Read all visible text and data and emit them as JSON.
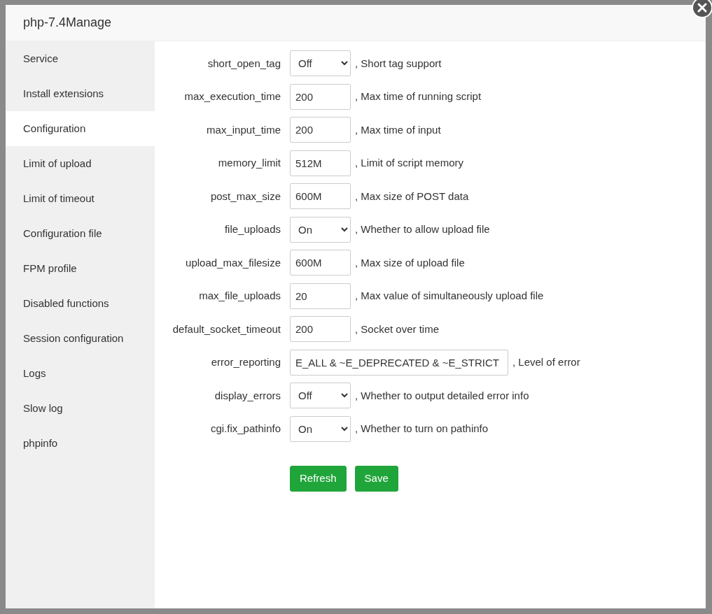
{
  "dialog": {
    "title": "php-7.4Manage"
  },
  "sidebar": {
    "items": [
      {
        "label": "Service",
        "selected": false
      },
      {
        "label": "Install extensions",
        "selected": false
      },
      {
        "label": "Configuration",
        "selected": true
      },
      {
        "label": "Limit of upload",
        "selected": false
      },
      {
        "label": "Limit of timeout",
        "selected": false
      },
      {
        "label": "Configuration file",
        "selected": false
      },
      {
        "label": "FPM profile",
        "selected": false
      },
      {
        "label": "Disabled functions",
        "selected": false
      },
      {
        "label": "Session configuration",
        "selected": false
      },
      {
        "label": "Logs",
        "selected": false
      },
      {
        "label": "Slow log",
        "selected": false
      },
      {
        "label": "phpinfo",
        "selected": false
      }
    ]
  },
  "settings": [
    {
      "label": "short_open_tag",
      "kind": "select",
      "value": "Off",
      "note": ", Short tag support"
    },
    {
      "label": "max_execution_time",
      "kind": "input",
      "value": "200",
      "note": ", Max time of running script"
    },
    {
      "label": "max_input_time",
      "kind": "input",
      "value": "200",
      "note": ", Max time of input"
    },
    {
      "label": "memory_limit",
      "kind": "input",
      "value": "512M",
      "note": ", Limit of script memory"
    },
    {
      "label": "post_max_size",
      "kind": "input",
      "value": "600M",
      "note": ", Max size of POST data"
    },
    {
      "label": "file_uploads",
      "kind": "select",
      "value": "On",
      "note": ", Whether to allow upload file"
    },
    {
      "label": "upload_max_filesize",
      "kind": "input",
      "value": "600M",
      "note": ", Max size of upload file"
    },
    {
      "label": "max_file_uploads",
      "kind": "input",
      "value": "20",
      "note": ", Max value of simultaneously upload file"
    },
    {
      "label": "default_socket_timeout",
      "kind": "input",
      "value": "200",
      "note": ", Socket over time"
    },
    {
      "label": "error_reporting",
      "kind": "wide-input",
      "value": "E_ALL & ~E_DEPRECATED & ~E_STRICT",
      "note": ", Level of error"
    },
    {
      "label": "display_errors",
      "kind": "select",
      "value": "Off",
      "note": ", Whether to output detailed error info"
    },
    {
      "label": "cgi.fix_pathinfo",
      "kind": "select",
      "value": "On",
      "note": ", Whether to turn on pathinfo"
    }
  ],
  "buttons": [
    {
      "label": "Refresh"
    },
    {
      "label": "Save"
    }
  ]
}
